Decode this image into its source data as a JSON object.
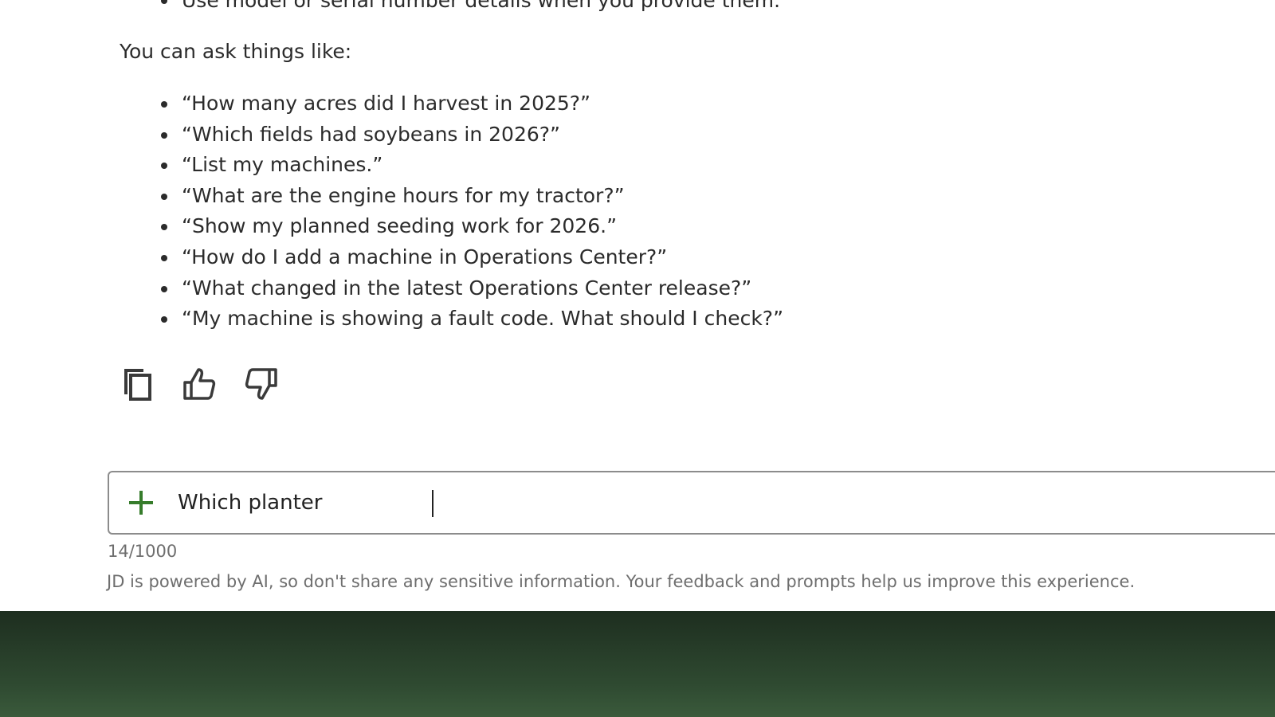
{
  "conversation": {
    "clipped_bullet": "Use model or serial number details when you provide them.",
    "intro_text": "You can ask things like:",
    "examples": [
      "“How many acres did I harvest in 2025?”",
      "“Which fields had soybeans in 2026?”",
      "“List my machines.”",
      "“What are the engine hours for my tractor?”",
      "“Show my planned seeding work for 2026.”",
      "“How do I add a machine in Operations Center?”",
      "“What changed in the latest Operations Center release?”",
      "“My machine is showing a fault code. What should I check?”"
    ]
  },
  "actions": {
    "icons": [
      "copy-icon",
      "thumbs-up-icon",
      "thumbs-down-icon"
    ]
  },
  "composer": {
    "value": "Which planter",
    "char_count": "14/1000",
    "add_icon": "plus-icon",
    "accent_color": "#367c2b"
  },
  "footer": {
    "disclaimer": "JD is powered by AI, so don't share any sensitive information. Your feedback and prompts help us improve this experience."
  }
}
